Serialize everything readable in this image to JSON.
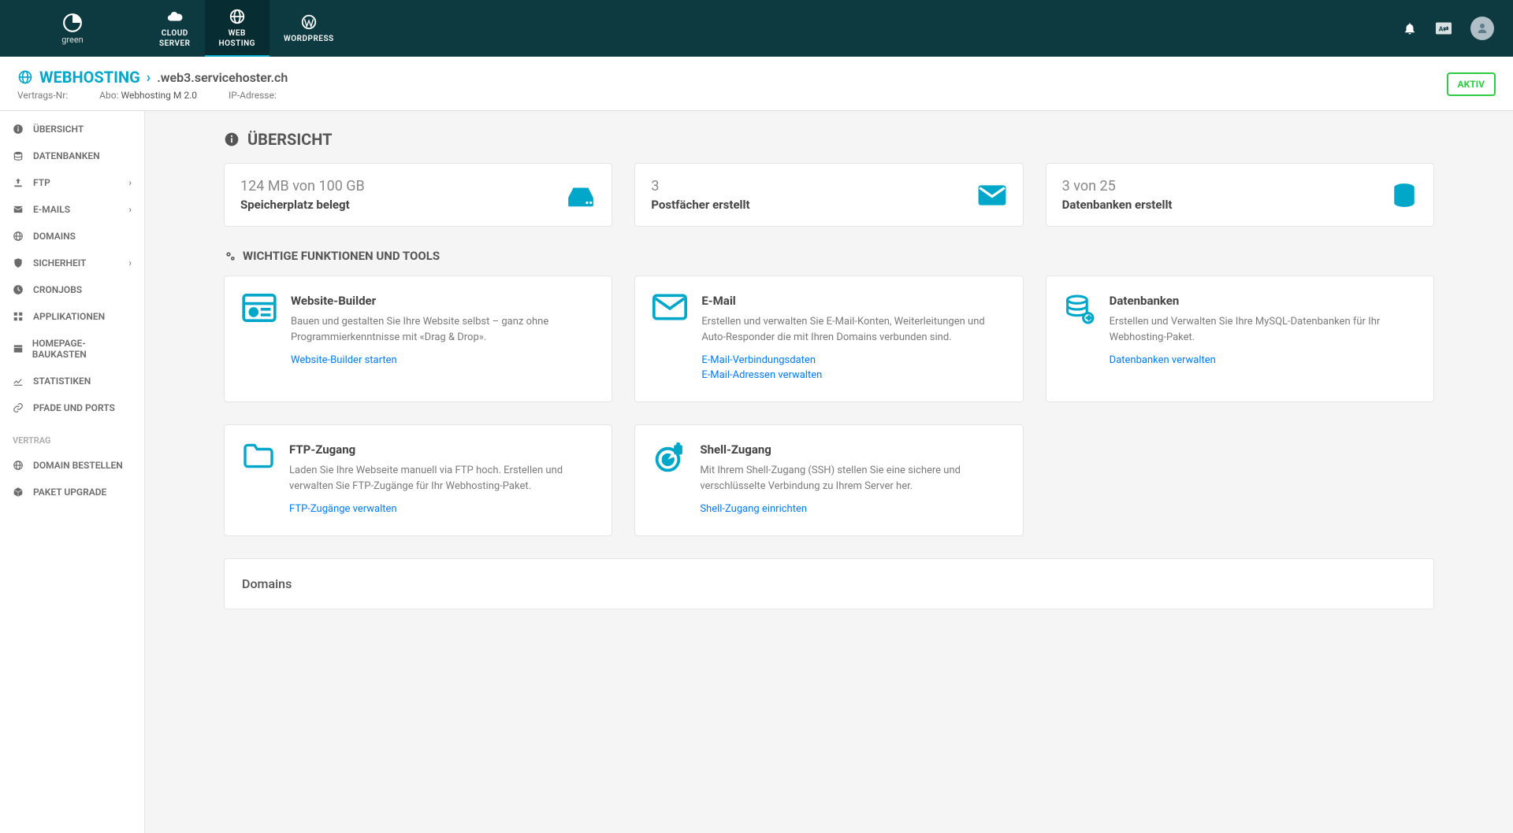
{
  "brand": {
    "name": "green"
  },
  "topnav": {
    "tabs": [
      {
        "line1": "CLOUD",
        "line2": "SERVER"
      },
      {
        "line1": "WEB",
        "line2": "HOSTING"
      },
      {
        "line1": "WORDPRESS",
        "line2": ""
      }
    ]
  },
  "subheader": {
    "title": "WEBHOSTING",
    "host": ".web3.servicehoster.ch",
    "contract_label": "Vertrags-Nr:",
    "contract_value": "",
    "abo_label": "Abo:",
    "abo_value": "Webhosting M 2.0",
    "ip_label": "IP-Adresse:",
    "ip_value": "",
    "status": "AKTIV"
  },
  "sidebar": {
    "items": [
      {
        "label": "ÜBERSICHT",
        "icon": "info",
        "expandable": false
      },
      {
        "label": "DATENBANKEN",
        "icon": "database",
        "expandable": false
      },
      {
        "label": "FTP",
        "icon": "upload",
        "expandable": true
      },
      {
        "label": "E-MAILS",
        "icon": "mail",
        "expandable": true
      },
      {
        "label": "DOMAINS",
        "icon": "globe",
        "expandable": false
      },
      {
        "label": "SICHERHEIT",
        "icon": "shield",
        "expandable": true
      },
      {
        "label": "CRONJOBS",
        "icon": "clock",
        "expandable": false
      },
      {
        "label": "APPLIKATIONEN",
        "icon": "apps",
        "expandable": false
      },
      {
        "label": "HOMEPAGE-BAUKASTEN",
        "icon": "layout",
        "expandable": false
      },
      {
        "label": "STATISTIKEN",
        "icon": "chart",
        "expandable": false
      },
      {
        "label": "PFADE UND PORTS",
        "icon": "link",
        "expandable": false
      }
    ],
    "section_label": "VERTRAG",
    "contract_items": [
      {
        "label": "DOMAIN BESTELLEN",
        "icon": "globe"
      },
      {
        "label": "PAKET UPGRADE",
        "icon": "package"
      }
    ]
  },
  "overview": {
    "title": "ÜBERSICHT",
    "stats": [
      {
        "value": "124 MB von 100 GB",
        "label": "Speicherplatz belegt"
      },
      {
        "value": "3",
        "label": "Postfächer erstellt"
      },
      {
        "value": "3 von 25",
        "label": "Datenbanken erstellt"
      }
    ],
    "tools_title": "WICHTIGE FUNKTIONEN UND TOOLS",
    "tools": [
      {
        "title": "Website-Builder",
        "desc": "Bauen und gestalten Sie Ihre Website selbst – ganz ohne Programmierkenntnisse mit «Drag & Drop».",
        "links": [
          "Website-Builder starten"
        ]
      },
      {
        "title": "E-Mail",
        "desc": "Erstellen und verwalten Sie E-Mail-Konten, Weiterleitungen und Auto-Responder die mit Ihren Domains verbunden sind.",
        "links": [
          "E-Mail-Verbindungsdaten",
          "E-Mail-Adressen verwalten"
        ]
      },
      {
        "title": "Datenbanken",
        "desc": "Erstellen und Verwalten Sie Ihre MySQL-Datenbanken für Ihr Webhosting-Paket.",
        "links": [
          "Datenbanken verwalten"
        ]
      },
      {
        "title": "FTP-Zugang",
        "desc": "Laden Sie Ihre Webseite manuell via FTP hoch. Erstellen und verwalten Sie FTP-Zugänge für Ihr Webhosting-Paket.",
        "links": [
          "FTP-Zugänge verwalten"
        ]
      },
      {
        "title": "Shell-Zugang",
        "desc": "Mit Ihrem Shell-Zugang (SSH) stellen Sie eine sichere und verschlüsselte Verbindung zu Ihrem Server her.",
        "links": [
          "Shell-Zugang einrichten"
        ]
      }
    ],
    "domains_title": "Domains"
  }
}
